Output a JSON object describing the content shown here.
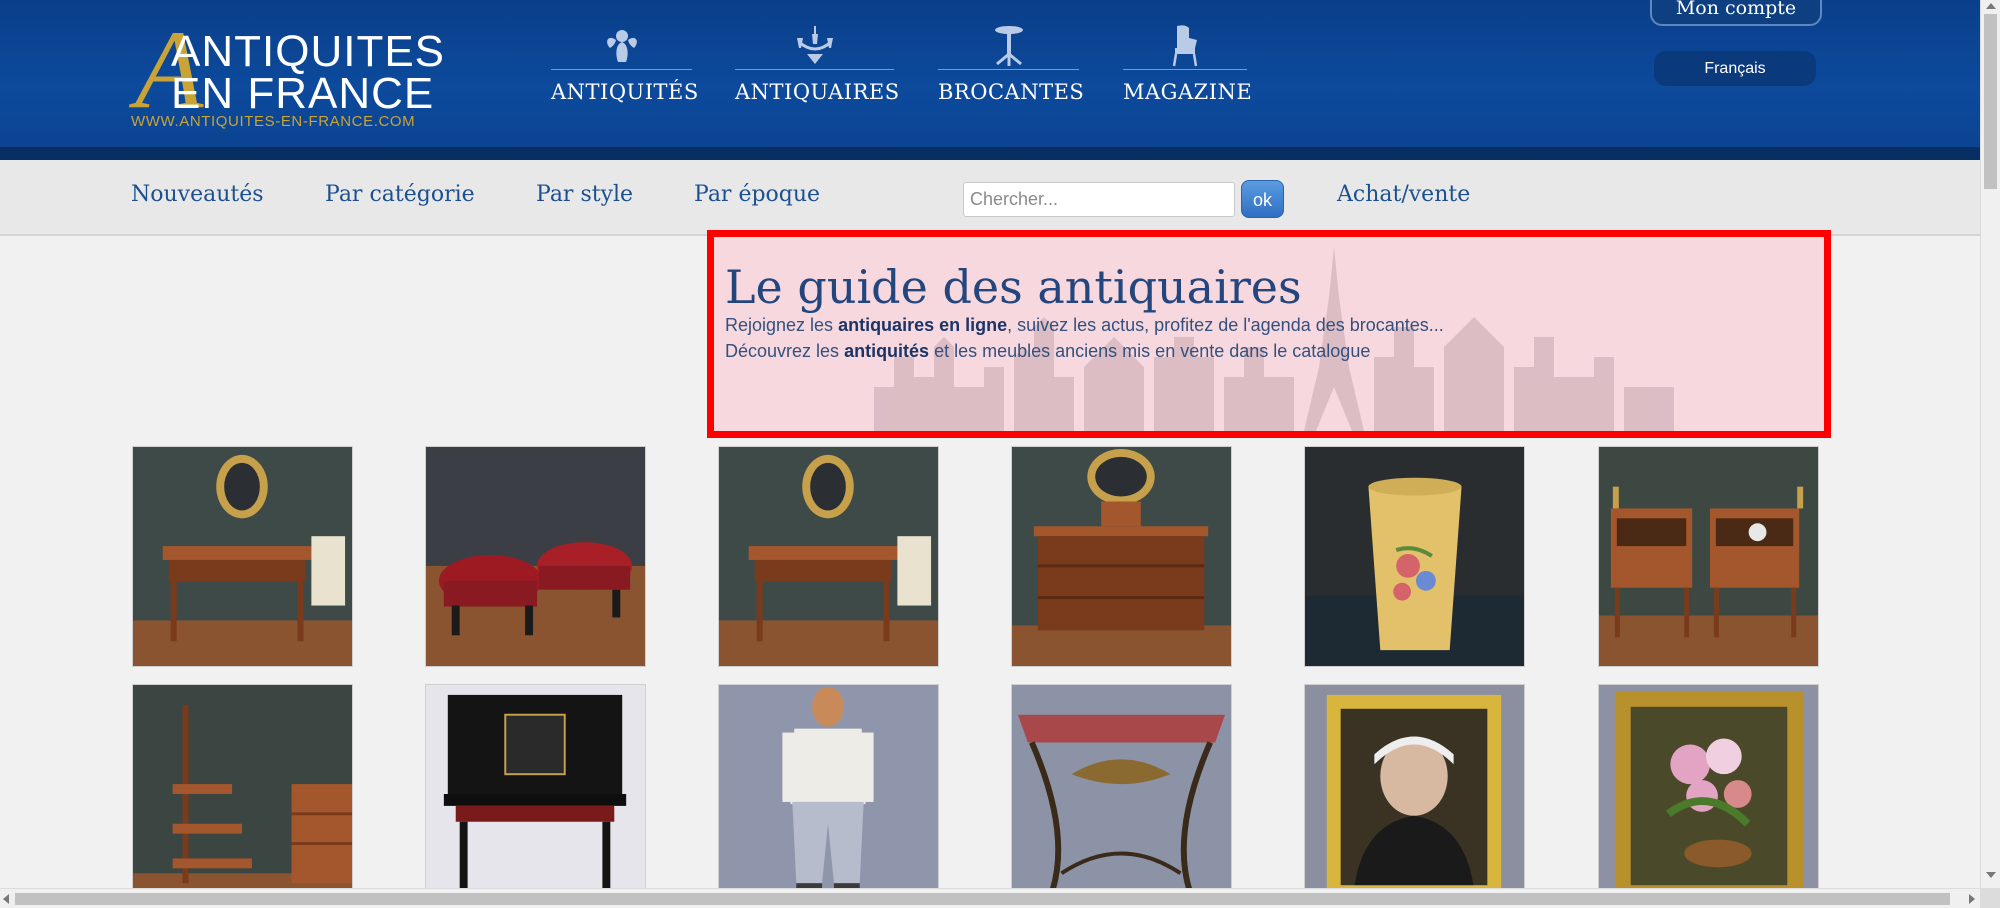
{
  "logo": {
    "line1": "ANTIQUITES",
    "line2": "EN FRANCE",
    "url": "WWW.ANTIQUITES-EN-FRANCE.COM"
  },
  "mainnav": [
    {
      "label": "ANTIQUITÉS",
      "icon": "cherub-icon"
    },
    {
      "label": "ANTIQUAIRES",
      "icon": "chandelier-icon"
    },
    {
      "label": "BROCANTES",
      "icon": "pedestal-table-icon"
    },
    {
      "label": "MAGAZINE",
      "icon": "armchair-icon"
    }
  ],
  "account": {
    "label": "Mon compte"
  },
  "language": {
    "label": "Français"
  },
  "subnav": [
    {
      "label": "Nouveautés"
    },
    {
      "label": "Par catégorie"
    },
    {
      "label": "Par style"
    },
    {
      "label": "Par époque"
    },
    {
      "label": "Achat/vente"
    }
  ],
  "search": {
    "placeholder": "Chercher...",
    "value": "",
    "button": "ok"
  },
  "intro": {
    "title": "Le guide des antiquaires",
    "line1_pre": "Rejoignez les ",
    "line1_bold": "antiquaires en ligne",
    "line1_post": ", suivez les actus, profitez de l'agenda des brocantes...",
    "line2_pre": "Découvrez les ",
    "line2_bold": "antiquités",
    "line2_post": " et les meubles anciens mis en vente dans le catalogue"
  },
  "colors": {
    "header": "#0d4a9c",
    "gold": "#c9a336",
    "nav_link": "#1c4f8f",
    "highlight_border": "#ff0000"
  },
  "products": [
    {
      "name": "desk-louis-xvi",
      "kind": "desk",
      "bg": "#3d4a47"
    },
    {
      "name": "pair-of-footstools",
      "kind": "stools",
      "bg": "#3b3f45"
    },
    {
      "name": "mahogany-desk",
      "kind": "desk",
      "bg": "#3d4a47"
    },
    {
      "name": "commode",
      "kind": "commode",
      "bg": "#3d4a47"
    },
    {
      "name": "painted-tole-vase",
      "kind": "vase",
      "bg": "#2a2d2f"
    },
    {
      "name": "pair-of-bedside-tables",
      "kind": "nightstands",
      "bg": "#3d4842"
    },
    {
      "name": "library-step-ladder",
      "kind": "ladder",
      "bg": "#3b4542"
    },
    {
      "name": "napoleon-iii-bureau",
      "kind": "bureau",
      "bg": "#e7e5ec"
    },
    {
      "name": "mannequin",
      "kind": "mannequin",
      "bg": "#8f96ab"
    },
    {
      "name": "console-table",
      "kind": "console",
      "bg": "#8c93a7"
    },
    {
      "name": "portrait-painting",
      "kind": "portrait",
      "bg": "#8b8fa0"
    },
    {
      "name": "flower-still-life",
      "kind": "flowers",
      "bg": "#8d91a3"
    }
  ]
}
